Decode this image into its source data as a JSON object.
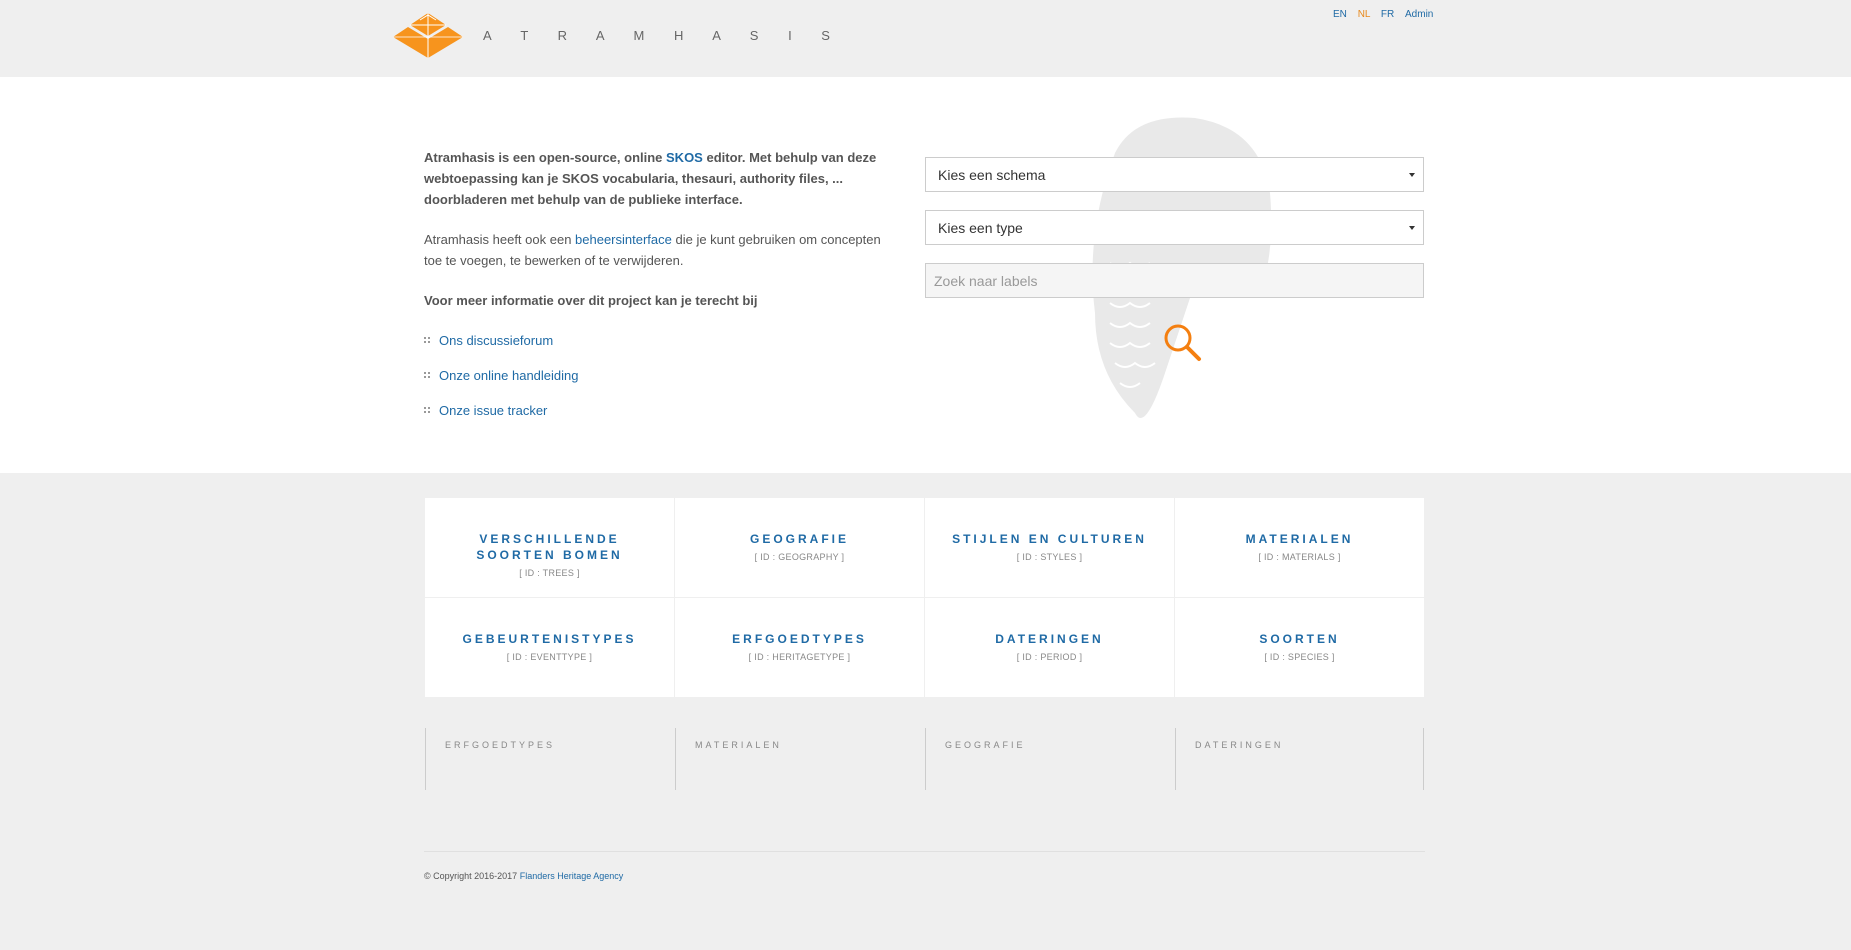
{
  "header": {
    "brand": "A T R A M H A S I S",
    "languages": [
      {
        "code": "EN",
        "active": false
      },
      {
        "code": "NL",
        "active": true
      },
      {
        "code": "FR",
        "active": false
      }
    ],
    "admin_label": "Admin"
  },
  "intro": {
    "p1_before": "Atramhasis is een open-source, online ",
    "p1_link": "SKOS",
    "p1_after": " editor. Met behulp van deze webtoepassing kan je SKOS vocabularia, thesauri, authority files, ... doorbladeren met behulp van de publieke interface.",
    "p2_before": "Atramhasis heeft ook een ",
    "p2_link": "beheersinterface",
    "p2_after": " die je kunt gebruiken om concepten toe te voegen, te bewerken of te verwijderen.",
    "p3": "Voor meer informatie over dit project kan je terecht bij",
    "links": [
      "Ons discussieforum",
      "Onze online handleiding",
      "Onze issue tracker"
    ]
  },
  "search": {
    "schema_select": "Kies een schema",
    "type_select": "Kies een type",
    "labels_placeholder": "Zoek naar labels"
  },
  "schemes": [
    {
      "title": "VERSCHILLENDE SOORTEN BOMEN",
      "id": "[ ID : TREES ]"
    },
    {
      "title": "GEOGRAFIE",
      "id": "[ ID : GEOGRAPHY ]"
    },
    {
      "title": "STIJLEN EN CULTUREN",
      "id": "[ ID : STYLES ]"
    },
    {
      "title": "MATERIALEN",
      "id": "[ ID : MATERIALS ]"
    },
    {
      "title": "GEBEURTENISTYPES",
      "id": "[ ID : EVENTTYPE ]"
    },
    {
      "title": "ERFGOEDTYPES",
      "id": "[ ID : HERITAGETYPE ]"
    },
    {
      "title": "DATERINGEN",
      "id": "[ ID : PERIOD ]"
    },
    {
      "title": "SOORTEN",
      "id": "[ ID : SPECIES ]"
    }
  ],
  "recent": [
    "ERFGOEDTYPES",
    "MATERIALEN",
    "GEOGRAFIE",
    "DATERINGEN"
  ],
  "footer": {
    "copyright": "© Copyright 2016-2017 ",
    "link": "Flanders Heritage Agency"
  },
  "colors": {
    "accent": "#f7941d",
    "link": "#1f6aa5",
    "page_bg": "#efefef"
  }
}
